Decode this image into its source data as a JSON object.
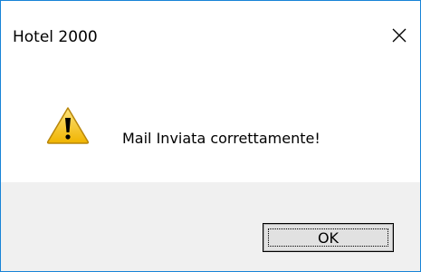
{
  "window": {
    "title": "Hotel 2000",
    "close_icon": "close-icon"
  },
  "message": {
    "icon": "warning-icon",
    "text": "Mail Inviata correttamente!"
  },
  "buttons": {
    "ok_label": "OK"
  },
  "colors": {
    "border": "#1883d7",
    "footer_bg": "#f0f0f0",
    "button_bg": "#e1e1e1",
    "warning_yellow": "#f4c430"
  }
}
